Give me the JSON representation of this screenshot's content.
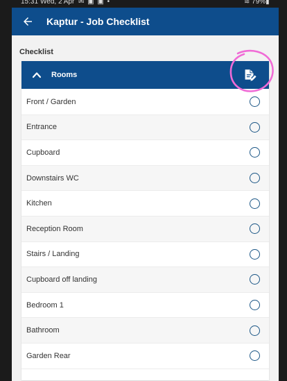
{
  "status_bar": {
    "time": "15:31",
    "date": "Wed, 2 Apr",
    "notifications": "✉ ▣ ▣ •",
    "right": "≋ 79%▮"
  },
  "app_bar": {
    "title": "Kaptur - Job Checklist",
    "back_icon": "arrow-left-icon",
    "color": "#0e4d8c"
  },
  "checklist": {
    "label": "Checklist",
    "section": {
      "title": "Rooms",
      "collapse_icon": "chevron-up-icon",
      "edit_icon": "edit-document-icon",
      "items": [
        {
          "label": "Front / Garden",
          "checked": false
        },
        {
          "label": "Entrance",
          "checked": false
        },
        {
          "label": "Cupboard",
          "checked": false
        },
        {
          "label": "Downstairs WC",
          "checked": false
        },
        {
          "label": "Kitchen",
          "checked": false
        },
        {
          "label": "Reception Room",
          "checked": false
        },
        {
          "label": "Stairs / Landing",
          "checked": false
        },
        {
          "label": "Cupboard off landing",
          "checked": false
        },
        {
          "label": "Bedroom 1",
          "checked": false
        },
        {
          "label": "Bathroom",
          "checked": false
        },
        {
          "label": "Garden Rear",
          "checked": false
        }
      ]
    }
  },
  "annotation_color": "#f06bd6"
}
